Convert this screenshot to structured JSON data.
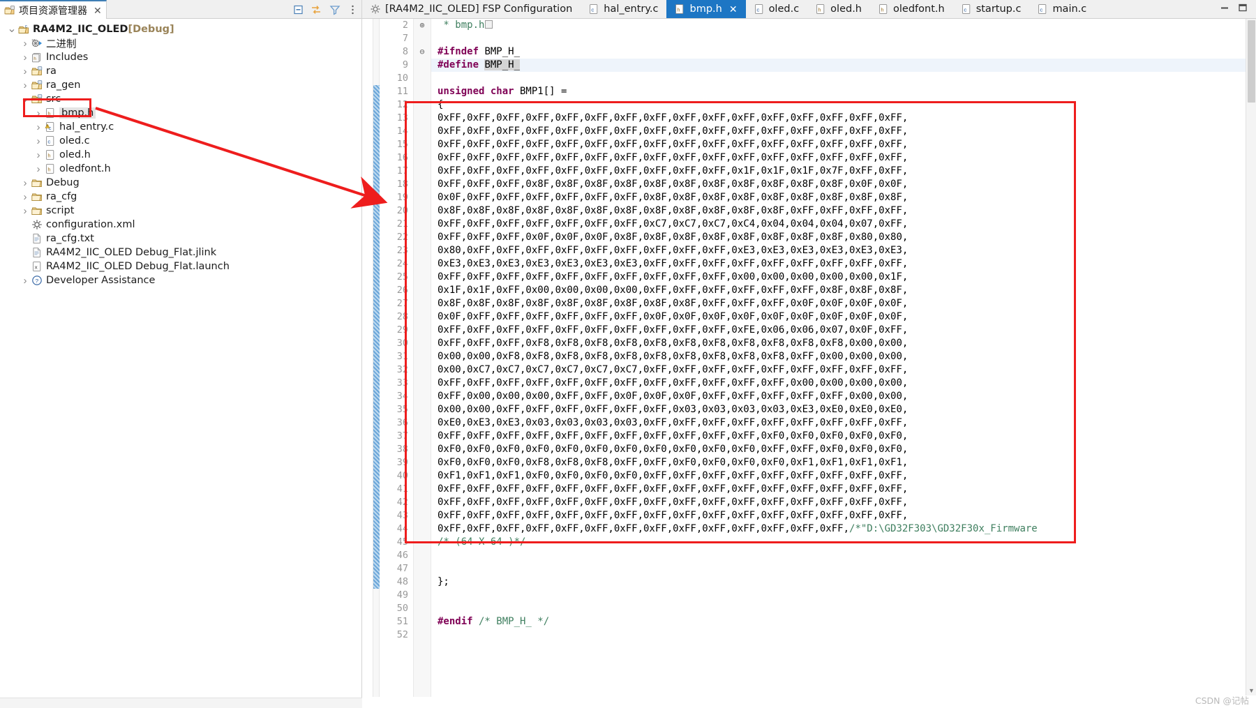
{
  "left_panel": {
    "tab_label": "项目资源管理器",
    "tab_close": "✕",
    "toolbar_icons": [
      "collapse-all-icon",
      "link-with-editor-icon",
      "filter-icon",
      "view-menu-icon"
    ],
    "tree": [
      {
        "indent": 0,
        "arrow": "v",
        "icon": "c-project-icon",
        "label": "RA4M2_IIC_OLED",
        "suffix": " [Debug]",
        "bold": true
      },
      {
        "indent": 1,
        "arrow": ">",
        "icon": "binaries-icon",
        "label": "二进制",
        "suffix": "",
        "bold": false
      },
      {
        "indent": 1,
        "arrow": ">",
        "icon": "includes-icon",
        "label": "Includes",
        "suffix": "",
        "bold": false
      },
      {
        "indent": 1,
        "arrow": ">",
        "icon": "source-folder-icon",
        "label": "ra",
        "suffix": "",
        "bold": false
      },
      {
        "indent": 1,
        "arrow": ">",
        "icon": "source-folder-icon",
        "label": "ra_gen",
        "suffix": "",
        "bold": false
      },
      {
        "indent": 1,
        "arrow": "v",
        "icon": "source-folder-icon",
        "label": "src",
        "suffix": "",
        "bold": false
      },
      {
        "indent": 2,
        "arrow": ">",
        "icon": "header-file-icon",
        "label": "bmp.h",
        "suffix": "",
        "bold": false,
        "selected": true
      },
      {
        "indent": 2,
        "arrow": ">",
        "icon": "c-file-warning-icon",
        "label": "hal_entry.c",
        "suffix": "",
        "bold": false
      },
      {
        "indent": 2,
        "arrow": ">",
        "icon": "c-file-icon",
        "label": "oled.c",
        "suffix": "",
        "bold": false
      },
      {
        "indent": 2,
        "arrow": ">",
        "icon": "header-file-icon",
        "label": "oled.h",
        "suffix": "",
        "bold": false
      },
      {
        "indent": 2,
        "arrow": ">",
        "icon": "header-file-icon",
        "label": "oledfont.h",
        "suffix": "",
        "bold": false
      },
      {
        "indent": 1,
        "arrow": ">",
        "icon": "folder-icon",
        "label": "Debug",
        "suffix": "",
        "bold": false
      },
      {
        "indent": 1,
        "arrow": ">",
        "icon": "folder-icon",
        "label": "ra_cfg",
        "suffix": "",
        "bold": false
      },
      {
        "indent": 1,
        "arrow": ">",
        "icon": "folder-icon",
        "label": "script",
        "suffix": "",
        "bold": false
      },
      {
        "indent": 1,
        "arrow": "",
        "icon": "xml-config-icon",
        "label": "configuration.xml",
        "suffix": "",
        "bold": false
      },
      {
        "indent": 1,
        "arrow": "",
        "icon": "text-file-icon",
        "label": "ra_cfg.txt",
        "suffix": "",
        "bold": false
      },
      {
        "indent": 1,
        "arrow": "",
        "icon": "text-file-icon",
        "label": "RA4M2_IIC_OLED Debug_Flat.jlink",
        "suffix": "",
        "bold": false
      },
      {
        "indent": 1,
        "arrow": "",
        "icon": "launch-file-icon",
        "label": "RA4M2_IIC_OLED Debug_Flat.launch",
        "suffix": "",
        "bold": false
      },
      {
        "indent": 1,
        "arrow": ">",
        "icon": "help-icon",
        "label": "Developer Assistance",
        "suffix": "",
        "bold": false
      }
    ]
  },
  "editor_tabs": [
    {
      "icon": "gear-icon",
      "label": "[RA4M2_IIC_OLED] FSP Configuration",
      "active": false,
      "closable": false
    },
    {
      "icon": "c-file-icon",
      "label": "hal_entry.c",
      "active": false,
      "closable": false
    },
    {
      "icon": "header-file-icon",
      "label": "bmp.h",
      "active": true,
      "closable": true,
      "close": "✕"
    },
    {
      "icon": "c-file-icon",
      "label": "oled.c",
      "active": false,
      "closable": false
    },
    {
      "icon": "header-file-icon",
      "label": "oled.h",
      "active": false,
      "closable": false
    },
    {
      "icon": "header-file-icon",
      "label": "oledfont.h",
      "active": false,
      "closable": false
    },
    {
      "icon": "c-file-icon",
      "label": "startup.c",
      "active": false,
      "closable": false
    },
    {
      "icon": "c-file-icon",
      "label": "main.c",
      "active": false,
      "closable": false
    }
  ],
  "window_controls": [
    "minimize-icon",
    "maximize-icon"
  ],
  "editor": {
    "accent_color": "#1d76c4",
    "annotation_color": "#ee1d1d",
    "comment_color": "#3f7f5f",
    "keyword_color": "#7f0055",
    "line_numbers": [
      2,
      7,
      8,
      9,
      10,
      11,
      12,
      13,
      14,
      15,
      16,
      17,
      18,
      19,
      20,
      21,
      22,
      23,
      24,
      25,
      26,
      27,
      28,
      29,
      30,
      31,
      32,
      33,
      34,
      35,
      36,
      37,
      38,
      39,
      40,
      41,
      42,
      43,
      44,
      45,
      46,
      47,
      48,
      49,
      50,
      51,
      52
    ],
    "fold_markers": {
      "0": "⊕",
      "2": "⊖"
    },
    "lines": [
      {
        "n": 2,
        "type": "comment",
        "text": " * bmp.h",
        "collapsed_marker": true
      },
      {
        "n": 7,
        "type": "blank",
        "text": ""
      },
      {
        "n": 8,
        "type": "pp",
        "text": "#ifndef",
        "rest": " BMP_H_"
      },
      {
        "n": 9,
        "type": "pp",
        "text": "#define",
        "rest": " BMP_H_",
        "highlight": true,
        "occurrence": "BMP_H_"
      },
      {
        "n": 10,
        "type": "blank",
        "text": ""
      },
      {
        "n": 11,
        "type": "decl",
        "kw": "unsigned char",
        "rest": " BMP1[] ="
      },
      {
        "n": 12,
        "type": "plain",
        "text": "{"
      },
      {
        "n": 13,
        "type": "hex",
        "text": "0xFF,0xFF,0xFF,0xFF,0xFF,0xFF,0xFF,0xFF,0xFF,0xFF,0xFF,0xFF,0xFF,0xFF,0xFF,0xFF,"
      },
      {
        "n": 14,
        "type": "hex",
        "text": "0xFF,0xFF,0xFF,0xFF,0xFF,0xFF,0xFF,0xFF,0xFF,0xFF,0xFF,0xFF,0xFF,0xFF,0xFF,0xFF,"
      },
      {
        "n": 15,
        "type": "hex",
        "text": "0xFF,0xFF,0xFF,0xFF,0xFF,0xFF,0xFF,0xFF,0xFF,0xFF,0xFF,0xFF,0xFF,0xFF,0xFF,0xFF,"
      },
      {
        "n": 16,
        "type": "hex",
        "text": "0xFF,0xFF,0xFF,0xFF,0xFF,0xFF,0xFF,0xFF,0xFF,0xFF,0xFF,0xFF,0xFF,0xFF,0xFF,0xFF,"
      },
      {
        "n": 17,
        "type": "hex",
        "text": "0xFF,0xFF,0xFF,0xFF,0xFF,0xFF,0xFF,0xFF,0xFF,0xFF,0x1F,0x1F,0x1F,0x7F,0xFF,0xFF,"
      },
      {
        "n": 18,
        "type": "hex",
        "text": "0xFF,0xFF,0xFF,0x8F,0x8F,0x8F,0x8F,0x8F,0x8F,0x8F,0x8F,0x8F,0x8F,0x8F,0x0F,0x0F,"
      },
      {
        "n": 19,
        "type": "hex",
        "text": "0x0F,0xFF,0xFF,0xFF,0xFF,0xFF,0xFF,0x8F,0x8F,0x8F,0x8F,0x8F,0x8F,0x8F,0x8F,0x8F,"
      },
      {
        "n": 20,
        "type": "hex",
        "text": "0x8F,0x8F,0x8F,0x8F,0x8F,0x8F,0x8F,0x8F,0x8F,0x8F,0x8F,0x8F,0xFF,0xFF,0xFF,0xFF,"
      },
      {
        "n": 21,
        "type": "hex",
        "text": "0xFF,0xFF,0xFF,0xFF,0xFF,0xFF,0xFF,0xC7,0xC7,0xC7,0xC4,0x04,0x04,0x04,0x07,0xFF,"
      },
      {
        "n": 22,
        "type": "hex",
        "text": "0xFF,0xFF,0xFF,0x0F,0x0F,0x0F,0x8F,0x8F,0x8F,0x8F,0x8F,0x8F,0x8F,0x8F,0x80,0x80,"
      },
      {
        "n": 23,
        "type": "hex",
        "text": "0x80,0xFF,0xFF,0xFF,0xFF,0xFF,0xFF,0xFF,0xFF,0xFF,0xE3,0xE3,0xE3,0xE3,0xE3,0xE3,"
      },
      {
        "n": 24,
        "type": "hex",
        "text": "0xE3,0xE3,0xE3,0xE3,0xE3,0xE3,0xE3,0xFF,0xFF,0xFF,0xFF,0xFF,0xFF,0xFF,0xFF,0xFF,"
      },
      {
        "n": 25,
        "type": "hex",
        "text": "0xFF,0xFF,0xFF,0xFF,0xFF,0xFF,0xFF,0xFF,0xFF,0xFF,0x00,0x00,0x00,0x00,0x00,0x1F,"
      },
      {
        "n": 26,
        "type": "hex",
        "text": "0x1F,0x1F,0xFF,0x00,0x00,0x00,0x00,0xFF,0xFF,0xFF,0xFF,0xFF,0xFF,0x8F,0x8F,0x8F,"
      },
      {
        "n": 27,
        "type": "hex",
        "text": "0x8F,0x8F,0x8F,0x8F,0x8F,0x8F,0x8F,0x8F,0x8F,0xFF,0xFF,0xFF,0x0F,0x0F,0x0F,0x0F,"
      },
      {
        "n": 28,
        "type": "hex",
        "text": "0x0F,0xFF,0xFF,0xFF,0xFF,0xFF,0xFF,0x0F,0x0F,0x0F,0x0F,0x0F,0x0F,0x0F,0x0F,0x0F,"
      },
      {
        "n": 29,
        "type": "hex",
        "text": "0xFF,0xFF,0xFF,0xFF,0xFF,0xFF,0xFF,0xFF,0xFF,0xFF,0xFE,0x06,0x06,0x07,0x0F,0xFF,"
      },
      {
        "n": 30,
        "type": "hex",
        "text": "0xFF,0xFF,0xFF,0xF8,0xF8,0xF8,0xF8,0xF8,0xF8,0xF8,0xF8,0xF8,0xF8,0xF8,0x00,0x00,"
      },
      {
        "n": 31,
        "type": "hex",
        "text": "0x00,0x00,0xF8,0xF8,0xF8,0xF8,0xF8,0xF8,0xF8,0xF8,0xF8,0xF8,0xFF,0x00,0x00,0x00,"
      },
      {
        "n": 32,
        "type": "hex",
        "text": "0x00,0xC7,0xC7,0xC7,0xC7,0xC7,0xC7,0xFF,0xFF,0xFF,0xFF,0xFF,0xFF,0xFF,0xFF,0xFF,"
      },
      {
        "n": 33,
        "type": "hex",
        "text": "0xFF,0xFF,0xFF,0xFF,0xFF,0xFF,0xFF,0xFF,0xFF,0xFF,0xFF,0xFF,0x00,0x00,0x00,0x00,"
      },
      {
        "n": 34,
        "type": "hex",
        "text": "0xFF,0x00,0x00,0x00,0xFF,0xFF,0x0F,0x0F,0x0F,0xFF,0xFF,0xFF,0xFF,0xFF,0x00,0x00,"
      },
      {
        "n": 35,
        "type": "hex",
        "text": "0x00,0x00,0xFF,0xFF,0xFF,0xFF,0xFF,0xFF,0x03,0x03,0x03,0x03,0xE3,0xE0,0xE0,0xE0,"
      },
      {
        "n": 36,
        "type": "hex",
        "text": "0xE0,0xE3,0xE3,0x03,0x03,0x03,0x03,0xFF,0xFF,0xFF,0xFF,0xFF,0xFF,0xFF,0xFF,0xFF,"
      },
      {
        "n": 37,
        "type": "hex",
        "text": "0xFF,0xFF,0xFF,0xFF,0xFF,0xFF,0xFF,0xFF,0xFF,0xFF,0xFF,0xF0,0xF0,0xF0,0xF0,0xF0,"
      },
      {
        "n": 38,
        "type": "hex",
        "text": "0xF0,0xF0,0xF0,0xF0,0xF0,0xF0,0xF0,0xF0,0xF0,0xF0,0xF0,0xFF,0xFF,0xF0,0xF0,0xF0,"
      },
      {
        "n": 39,
        "type": "hex",
        "text": "0xF0,0xF0,0xF0,0xF8,0xF8,0xF8,0xFF,0xFF,0xF0,0xF0,0xF0,0xF0,0xF1,0xF1,0xF1,0xF1,"
      },
      {
        "n": 40,
        "type": "hex",
        "text": "0xF1,0xF1,0xF1,0xF0,0xF0,0xF0,0xF0,0xFF,0xFF,0xFF,0xFF,0xFF,0xFF,0xFF,0xFF,0xFF,"
      },
      {
        "n": 41,
        "type": "hex",
        "text": "0xFF,0xFF,0xFF,0xFF,0xFF,0xFF,0xFF,0xFF,0xFF,0xFF,0xFF,0xFF,0xFF,0xFF,0xFF,0xFF,"
      },
      {
        "n": 42,
        "type": "hex",
        "text": "0xFF,0xFF,0xFF,0xFF,0xFF,0xFF,0xFF,0xFF,0xFF,0xFF,0xFF,0xFF,0xFF,0xFF,0xFF,0xFF,"
      },
      {
        "n": 43,
        "type": "hex",
        "text": "0xFF,0xFF,0xFF,0xFF,0xFF,0xFF,0xFF,0xFF,0xFF,0xFF,0xFF,0xFF,0xFF,0xFF,0xFF,0xFF,"
      },
      {
        "n": 44,
        "type": "hex_comment",
        "text": "0xFF,0xFF,0xFF,0xFF,0xFF,0xFF,0xFF,0xFF,0xFF,0xFF,0xFF,0xFF,0xFF,0xFF,",
        "comment": "/*\"D:\\GD32F303\\GD32F30x_Firmware"
      },
      {
        "n": 45,
        "type": "comment_only",
        "text": "/* (64 X 64 )*/"
      },
      {
        "n": 46,
        "type": "blank",
        "text": ""
      },
      {
        "n": 47,
        "type": "blank",
        "text": ""
      },
      {
        "n": 48,
        "type": "plain",
        "text": "};"
      },
      {
        "n": 49,
        "type": "blank",
        "text": ""
      },
      {
        "n": 50,
        "type": "blank",
        "text": ""
      },
      {
        "n": 51,
        "type": "endif",
        "kw": "#endif",
        "comment": " /* BMP_H_ */"
      },
      {
        "n": 52,
        "type": "blank",
        "text": ""
      }
    ]
  },
  "watermark": "CSDN @记帖"
}
